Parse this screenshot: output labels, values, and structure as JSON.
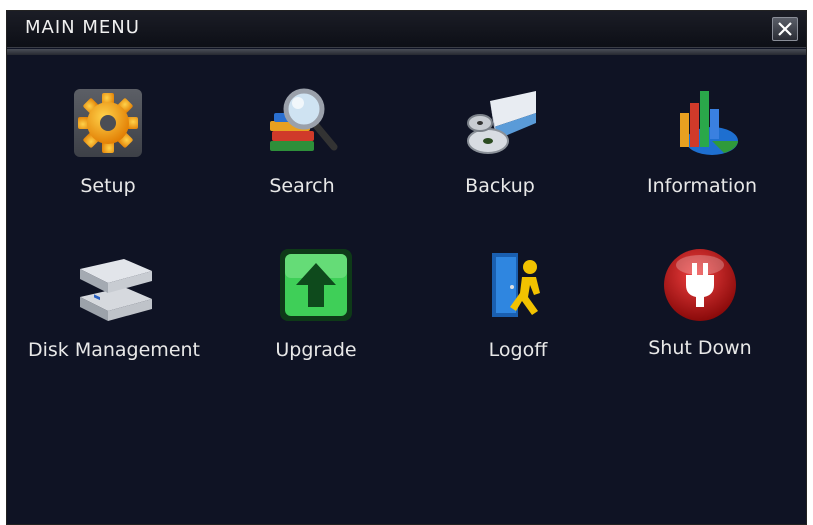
{
  "window": {
    "title": "MAIN MENU",
    "close_icon": "close-icon"
  },
  "menu": {
    "items": [
      {
        "label": "Setup",
        "icon": "gear-icon"
      },
      {
        "label": "Search",
        "icon": "search-books-icon"
      },
      {
        "label": "Backup",
        "icon": "disc-drive-icon"
      },
      {
        "label": "Information",
        "icon": "bar-chart-icon"
      },
      {
        "label": "Disk Management",
        "icon": "hard-disk-icon"
      },
      {
        "label": "Upgrade",
        "icon": "upgrade-arrow-icon"
      },
      {
        "label": "Logoff",
        "icon": "logoff-door-icon"
      },
      {
        "label": "Shut Down",
        "icon": "power-plug-icon"
      }
    ]
  },
  "colors": {
    "background": "#0f1324",
    "title_text": "#f0f0f0",
    "label_text": "#e8e8e8"
  }
}
